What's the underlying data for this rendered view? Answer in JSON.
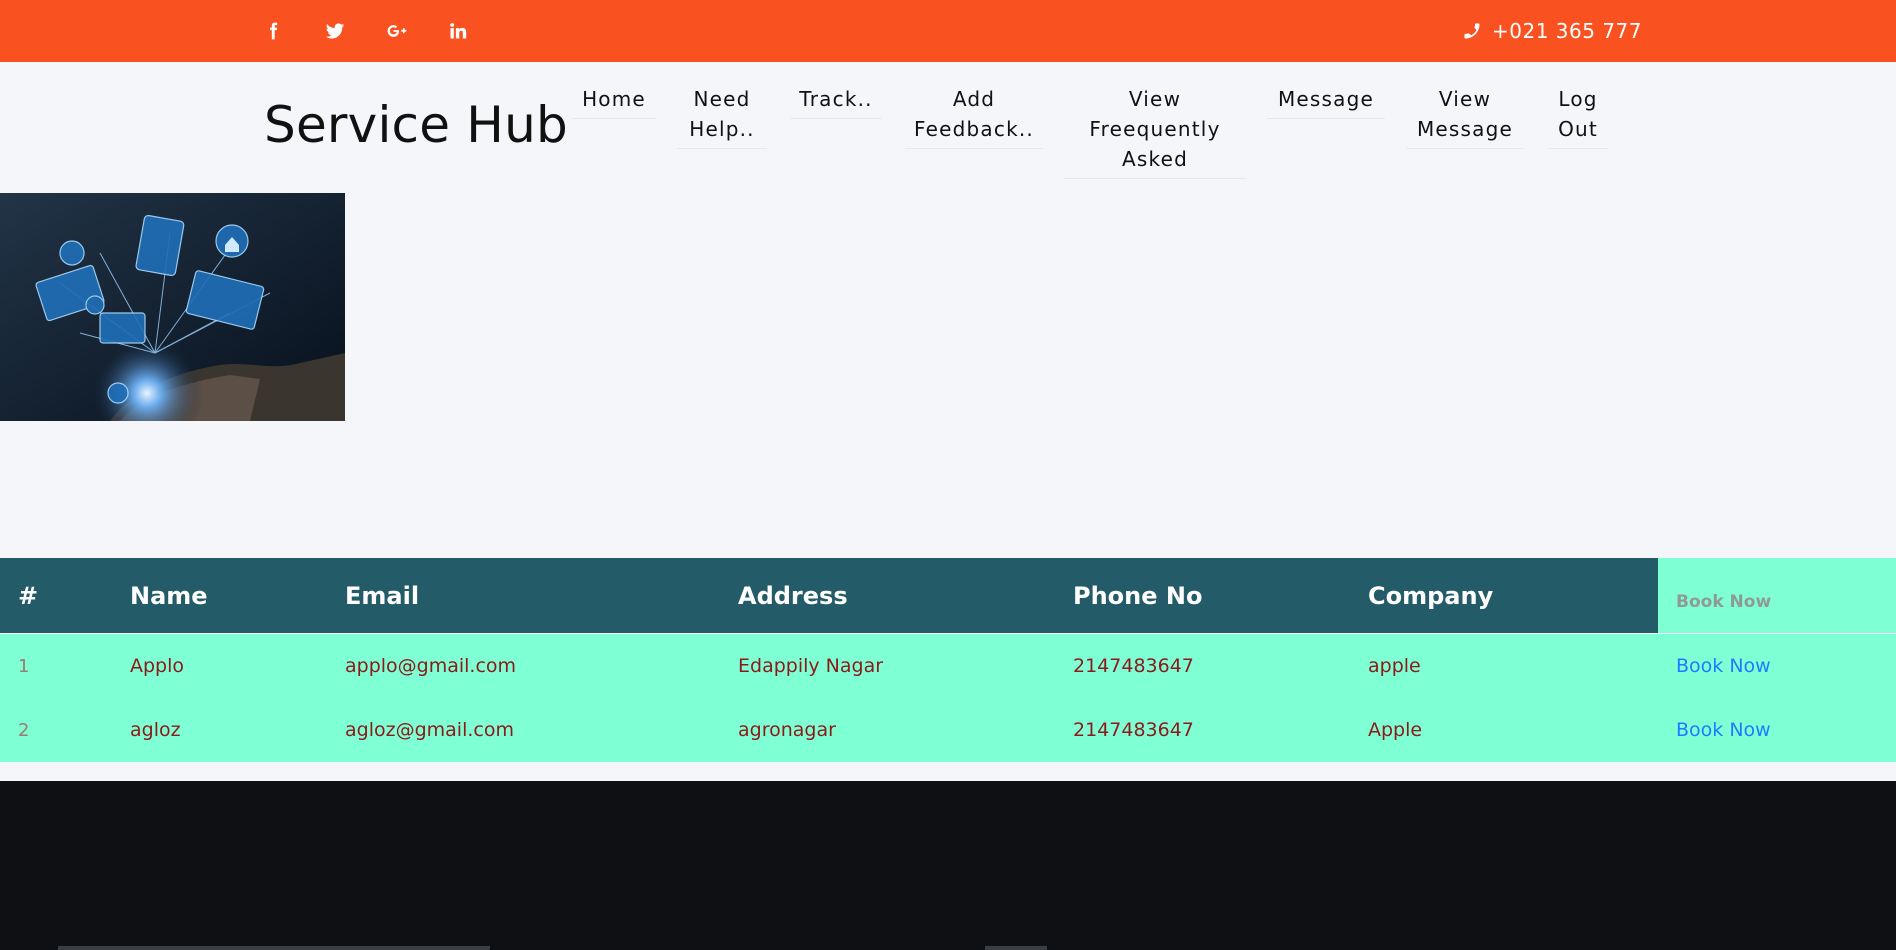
{
  "topbar": {
    "social": [
      {
        "icon": "facebook-icon"
      },
      {
        "icon": "twitter-icon"
      },
      {
        "icon": "google-plus-icon"
      },
      {
        "icon": "linkedin-icon"
      }
    ],
    "phone": "+021 365 777",
    "color": "#f95220"
  },
  "brand": "Service Hub",
  "nav": [
    {
      "line1": "Home",
      "line2": "",
      "line3": ""
    },
    {
      "line1": "Need",
      "line2": "Help..",
      "line3": ""
    },
    {
      "line1": "Track..",
      "line2": "",
      "line3": ""
    },
    {
      "line1": "Add",
      "line2": "Feedback..",
      "line3": ""
    },
    {
      "line1": "View",
      "line2": "Freequently",
      "line3": "Asked"
    },
    {
      "line1": "Message",
      "line2": "",
      "line3": ""
    },
    {
      "line1": "View",
      "line2": "Message",
      "line3": ""
    },
    {
      "line1": "Log",
      "line2": "Out",
      "line3": ""
    }
  ],
  "table": {
    "headers": [
      "#",
      "Name",
      "Email",
      "Address",
      "Phone No",
      "Company",
      "Book Now"
    ],
    "rows": [
      {
        "num": "1",
        "name": "Applo",
        "email": "applo@gmail.com",
        "address": "Edappily Nagar",
        "phone": "2147483647",
        "company": "apple",
        "action": "Book Now"
      },
      {
        "num": "2",
        "name": "agloz",
        "email": "agloz@gmail.com",
        "address": "agronagar",
        "phone": "2147483647",
        "company": "Apple",
        "action": "Book Now"
      }
    ],
    "header_color": "#235c68",
    "row_color": "#7fffd4"
  }
}
